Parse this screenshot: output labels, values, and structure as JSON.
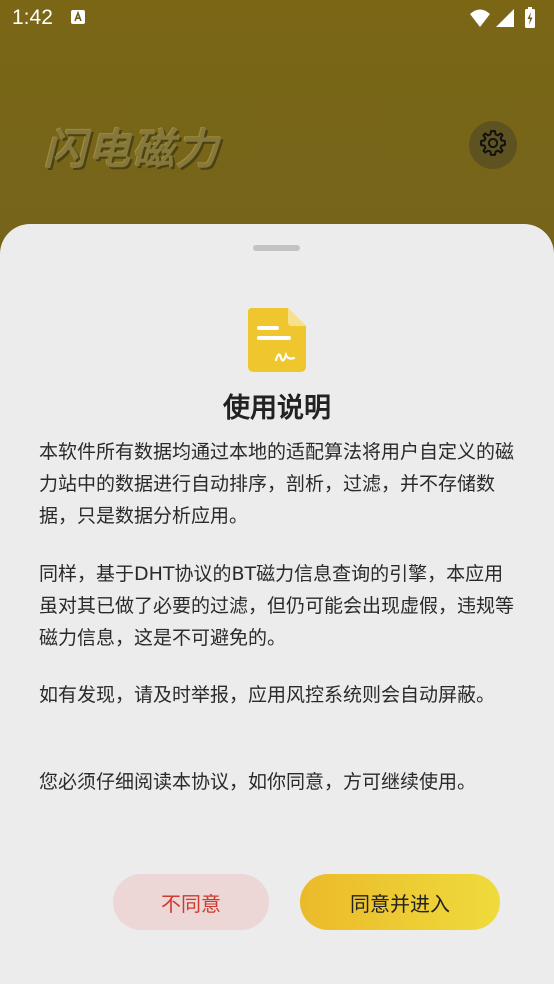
{
  "status_bar": {
    "time": "1:42",
    "app_icon": "font-A-icon",
    "icons": [
      "wifi-icon",
      "signal-icon",
      "battery-charging-icon"
    ]
  },
  "app": {
    "title": "闪电磁力",
    "settings_icon": "gear-icon"
  },
  "dialog": {
    "icon": "document-signature-icon",
    "title": "使用说明",
    "paragraphs": [
      "本软件所有数据均通过本地的适配算法将用户自定义的磁力站中的数据进行自动排序，剖析，过滤，并不存储数据，只是数据分析应用。",
      "同样，基于DHT协议的BT磁力信息查询的引擎，本应用虽对其已做了必要的过滤，但仍可能会出现虚假，违规等磁力信息，这是不可避免的。",
      "如有发现，请及时举报，应用风控系统则会自动屏蔽。",
      "您必须仔细阅读本协议，如你同意，方可继续使用。"
    ],
    "disagree_label": "不同意",
    "agree_label": "同意并进入"
  },
  "colors": {
    "accent_yellow": "#efc62e",
    "disagree_text": "#d0392e",
    "sheet_background": "#ececec"
  }
}
